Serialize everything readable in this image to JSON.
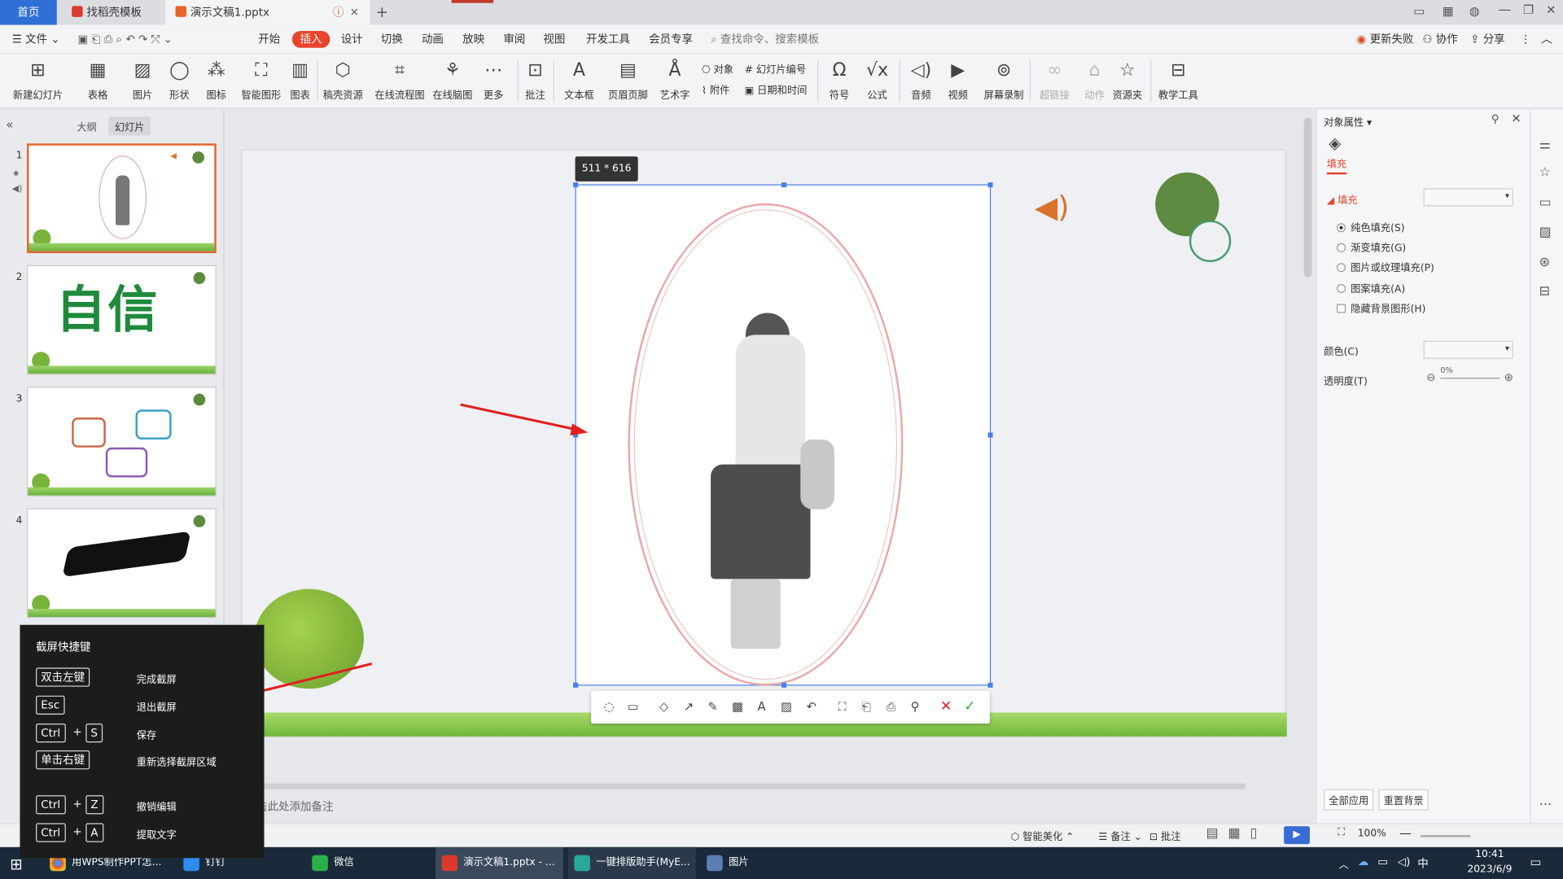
{
  "tabs": [
    {
      "label": "首页"
    },
    {
      "label": "找稻壳模板"
    },
    {
      "label": "演示文稿1.pptx"
    }
  ],
  "menu": {
    "file": "文件",
    "items": [
      "开始",
      "插入",
      "设计",
      "切换",
      "动画",
      "放映",
      "审阅",
      "视图",
      "开发工具",
      "会员专享"
    ],
    "active": "插入",
    "search_placeholder": "查找命令、搜索模板",
    "right": [
      "更新失败",
      "协作",
      "分享"
    ]
  },
  "ribbon": {
    "buttons": [
      {
        "label": "新建幻灯片",
        "icon": "new-slide-icon"
      },
      {
        "label": "表格",
        "icon": "table-icon"
      },
      {
        "label": "图片",
        "icon": "picture-icon"
      },
      {
        "label": "形状",
        "icon": "shape-icon"
      },
      {
        "label": "图标",
        "icon": "icons-icon"
      },
      {
        "label": "智能图形",
        "icon": "smartart-icon"
      },
      {
        "label": "图表",
        "icon": "chart-icon"
      },
      {
        "label": "稿壳资源",
        "icon": "resource-icon"
      },
      {
        "label": "在线流程图",
        "icon": "flowchart-icon"
      },
      {
        "label": "在线脑图",
        "icon": "mindmap-icon"
      },
      {
        "label": "更多",
        "icon": "more-icon"
      },
      {
        "label": "批注",
        "icon": "comment-icon"
      },
      {
        "label": "文本框",
        "icon": "textbox-icon"
      },
      {
        "label": "页眉页脚",
        "icon": "header-footer-icon"
      },
      {
        "label": "艺术字",
        "icon": "wordart-icon"
      },
      {
        "label": "符号",
        "icon": "symbol-icon"
      },
      {
        "label": "公式",
        "icon": "formula-icon"
      },
      {
        "label": "音频",
        "icon": "audio-icon"
      },
      {
        "label": "视频",
        "icon": "video-icon"
      },
      {
        "label": "屏幕录制",
        "icon": "screen-record-icon"
      },
      {
        "label": "超链接",
        "icon": "hyperlink-icon"
      },
      {
        "label": "动作",
        "icon": "action-icon"
      },
      {
        "label": "资源夹",
        "icon": "resource-folder-icon"
      },
      {
        "label": "教学工具",
        "icon": "teaching-tool-icon"
      }
    ],
    "small": [
      "对象",
      "幻灯片编号",
      "附件",
      "日期和时间"
    ]
  },
  "left_panel": {
    "tabs": [
      "大纲",
      "幻灯片"
    ],
    "slides": [
      {
        "num": "1"
      },
      {
        "num": "2",
        "text": "自信"
      },
      {
        "num": "3"
      },
      {
        "num": "4"
      }
    ]
  },
  "screenshot": {
    "size_label": "511 * 616"
  },
  "shortcut_panel": {
    "title": "截屏快捷键",
    "rows": [
      {
        "keys": [
          "双击左键"
        ],
        "desc": "完成截屏"
      },
      {
        "keys": [
          "Esc"
        ],
        "desc": "退出截屏"
      },
      {
        "keys": [
          "Ctrl",
          "S"
        ],
        "desc": "保存"
      },
      {
        "keys": [
          "单击右键"
        ],
        "desc": "重新选择截屏区域"
      },
      {
        "keys": [
          "Ctrl",
          "Z"
        ],
        "desc": "撤销编辑"
      },
      {
        "keys": [
          "Ctrl",
          "A"
        ],
        "desc": "提取文字"
      }
    ]
  },
  "notes_placeholder": "单击此处添加备注",
  "right_panel": {
    "title": "对象属性",
    "tab": "填充",
    "section": "填充",
    "options": [
      "纯色填充(S)",
      "渐变填充(G)",
      "图片或纹理填充(P)",
      "图案填充(A)"
    ],
    "checkbox": "隐藏背景图形(H)",
    "color_label": "颜色(C)",
    "transparency_label": "透明度(T)",
    "transparency_value": "0%",
    "apply_all": "全部应用",
    "reset_bg": "重置背景"
  },
  "statusbar": {
    "smart": "智能美化",
    "notes": "备注",
    "comment": "批注",
    "zoom": "100%"
  },
  "taskbar": {
    "items": [
      "用WPS制作PPT怎...",
      "钉钉",
      "微信",
      "演示文稿1.pptx - ...",
      "一键排版助手(MyE...",
      "图片"
    ],
    "time": "10:41",
    "date": "2023/6/9",
    "ime": "中"
  },
  "colors": {
    "accent": "#e8452c",
    "selection": "#4a7fe8",
    "brand_green": "#5e8a3c",
    "arrow_red": "#e02020"
  }
}
